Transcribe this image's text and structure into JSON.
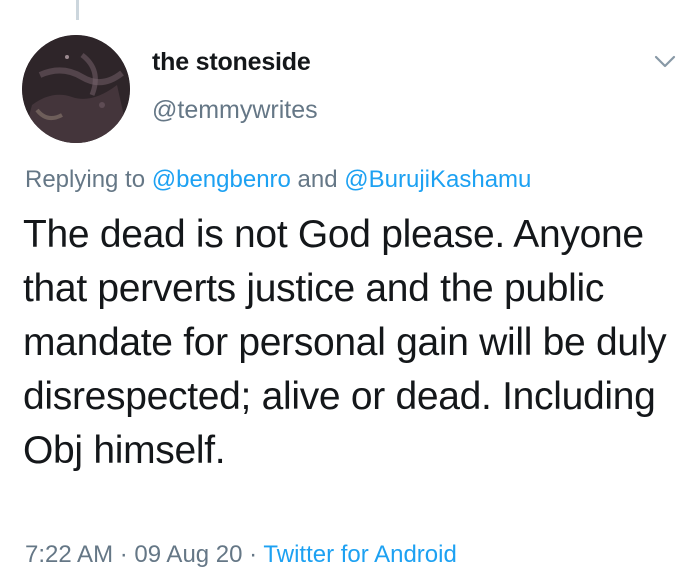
{
  "user": {
    "display_name": "the stoneside",
    "handle": "@temmywrites"
  },
  "reply": {
    "prefix": "Replying to ",
    "mention_1": "@bengbenro",
    "conjunction": " and ",
    "mention_2": "@BurujiKashamu"
  },
  "tweet": {
    "text": "The dead is not God please. Anyone that perverts justice and the public mandate for personal gain will be duly disrespected; alive or dead. Including Obj himself."
  },
  "meta": {
    "time": "7:22 AM",
    "separator_1": " · ",
    "date": "09 Aug 20",
    "separator_2": " · ",
    "source": "Twitter for Android"
  },
  "icons": {
    "caret": "chevron-down-icon"
  },
  "colors": {
    "text": "#14171a",
    "secondary": "#657786",
    "link": "#1da1f2"
  }
}
